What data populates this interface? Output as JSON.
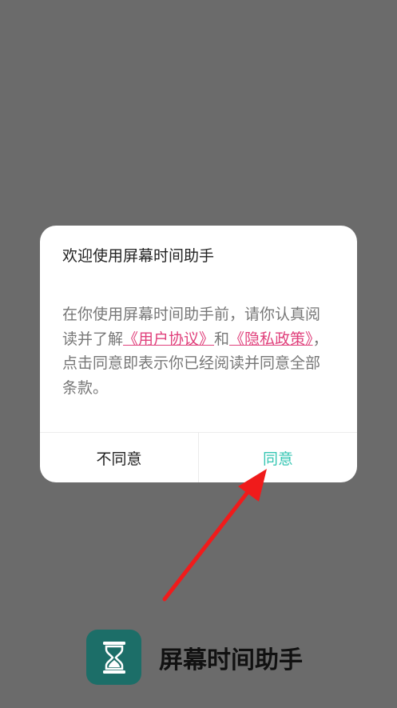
{
  "dialog": {
    "title": "欢迎使用屏幕时间助手",
    "body": {
      "text_before": "在你使用屏幕时间助手前，请你认真阅读并了解",
      "user_agreement_link": "《用户协议》",
      "text_and": "和",
      "privacy_policy_link": "《隐私政策》",
      "text_after": "，点击同意即表示你已经阅读并同意全部条款。"
    },
    "buttons": {
      "disagree": "不同意",
      "agree": "同意"
    }
  },
  "app": {
    "name": "屏幕时间助手",
    "icon": "hourglass-icon"
  },
  "colors": {
    "overlay": "#6b6b6b",
    "link": "#e0417c",
    "accent": "#36c6b3",
    "app_icon_bg": "#1c6e68",
    "annotation_arrow": "#f01b1b"
  }
}
